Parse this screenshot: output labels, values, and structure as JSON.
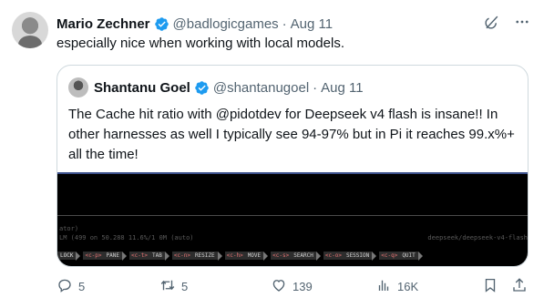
{
  "author": {
    "name": "Mario Zechner",
    "handle": "@badlogicgames",
    "date": "Aug 11"
  },
  "post_text": "especially nice when working with local models.",
  "quoted": {
    "name": "Shantanu Goel",
    "handle": "@shantanugoel",
    "date": "Aug 11",
    "text": "The Cache hit ratio with @pidotdev for Deepseek v4 flash is insane!! In other harnesses as well I typically see 94-97% but in Pi it reaches 99.x%+ all the time!",
    "terminal": {
      "label": "ator)",
      "status": "LM (499 on 50.288 11.6%/1 0M (auto)",
      "model": "deepseek/deepseek-v4-flash",
      "keys": [
        {
          "mod": "",
          "act": "LOCK"
        },
        {
          "mod": "<c-p>",
          "act": "PANE"
        },
        {
          "mod": "<c-t>",
          "act": "TAB"
        },
        {
          "mod": "<c-n>",
          "act": "RESIZE"
        },
        {
          "mod": "<c-h>",
          "act": "MOVE"
        },
        {
          "mod": "<c-s>",
          "act": "SEARCH"
        },
        {
          "mod": "<c-o>",
          "act": "SESSION"
        },
        {
          "mod": "<c-q>",
          "act": "QUIT"
        }
      ]
    }
  },
  "metrics": {
    "replies": "5",
    "reposts": "5",
    "likes": "139",
    "views": "16K"
  },
  "icons": {
    "verified": "verified-badge-icon",
    "grok": "grok-icon",
    "more": "more-icon",
    "reply": "reply-icon",
    "repost": "repost-icon",
    "like": "heart-icon",
    "views": "views-icon",
    "bookmark": "bookmark-icon",
    "share": "share-icon"
  },
  "colors": {
    "verified": "#1d9bf0",
    "muted": "#536471",
    "text": "#0f1419",
    "border": "#cfd9de"
  }
}
